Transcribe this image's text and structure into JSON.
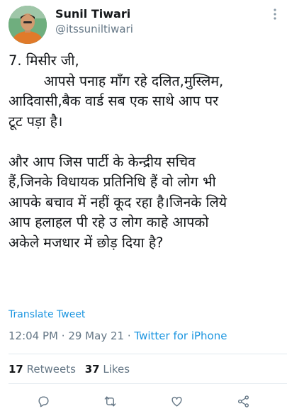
{
  "author": {
    "display_name": "Sunil Tiwari",
    "handle": "@itssuniltiwari"
  },
  "tweet": {
    "text": "7. मिसीर जी,\n        आपसे पनाह माँग रहे दलित,मुस्लिम,\nआदिवासी,बैक वार्ड सब एक साथे आप पर\nटूट पड़ा है।\n\nऔर आप जिस पार्टी के केन्द्रीय सचिव\nहैं,जिनके विधायक प्रतिनिधि हैं वो लोग भी\nआपके बचाव में नहीं कूद रहा है।जिनके लिये\nआप हलाहल पी रहे उ लोग काहे आपको\nअकेले मजधार में छोड़ दिया है?",
    "translate_label": "Translate Tweet",
    "time": "12:04 PM",
    "date": "29 May 21",
    "separator": "·",
    "source": "Twitter for iPhone"
  },
  "stats": {
    "retweets_count": "17",
    "retweets_label": "Retweets",
    "likes_count": "37",
    "likes_label": "Likes"
  },
  "actions": [
    "reply-icon",
    "retweet-icon",
    "like-icon",
    "share-icon"
  ],
  "colors": {
    "link": "#1b95e0",
    "muted": "#657786",
    "text": "#14171a",
    "divider": "#e1e8ed"
  }
}
